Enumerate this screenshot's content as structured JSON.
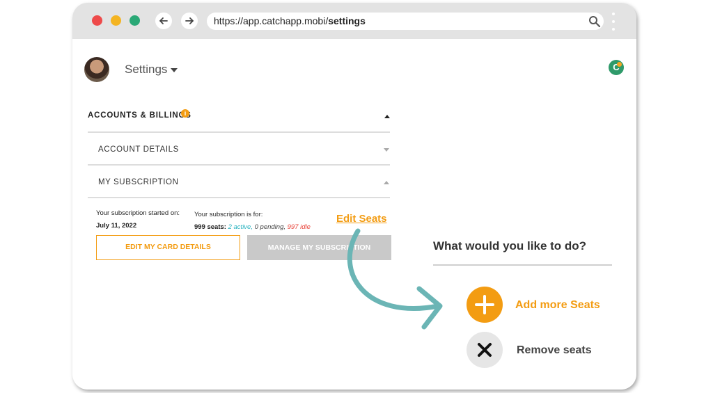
{
  "browser": {
    "url_prefix": "https://app.catchapp.mobi/",
    "url_path": "settings"
  },
  "header": {
    "title": "Settings",
    "logo_letter": "C"
  },
  "accounts": {
    "section_title": "ACCOUNTS & BILLINGS",
    "info_badge": "i",
    "rows": [
      {
        "label": "ACCOUNT DETAILS"
      },
      {
        "label": "MY SUBSCRIPTION"
      }
    ]
  },
  "subscription": {
    "started_label": "Your subscription started on:",
    "started_date": "July 11, 2022",
    "for_label": "Your subscription is for:",
    "seats": "999 seats:",
    "active": "2 active,",
    "pending": "0 pending,",
    "idle": "997 idle",
    "edit_seats": "Edit Seats",
    "edit_card_btn": "EDIT MY CARD DETAILS",
    "manage_btn": "MANAGE MY SUBSCRIPTION"
  },
  "panel": {
    "title": "What would you like to do?",
    "add_label": "Add more Seats",
    "remove_label": "Remove seats"
  },
  "colors": {
    "accent": "#f39c12",
    "teal_arrow": "#6bb5b5",
    "active": "#2bb3c0",
    "idle": "#e8443a"
  }
}
